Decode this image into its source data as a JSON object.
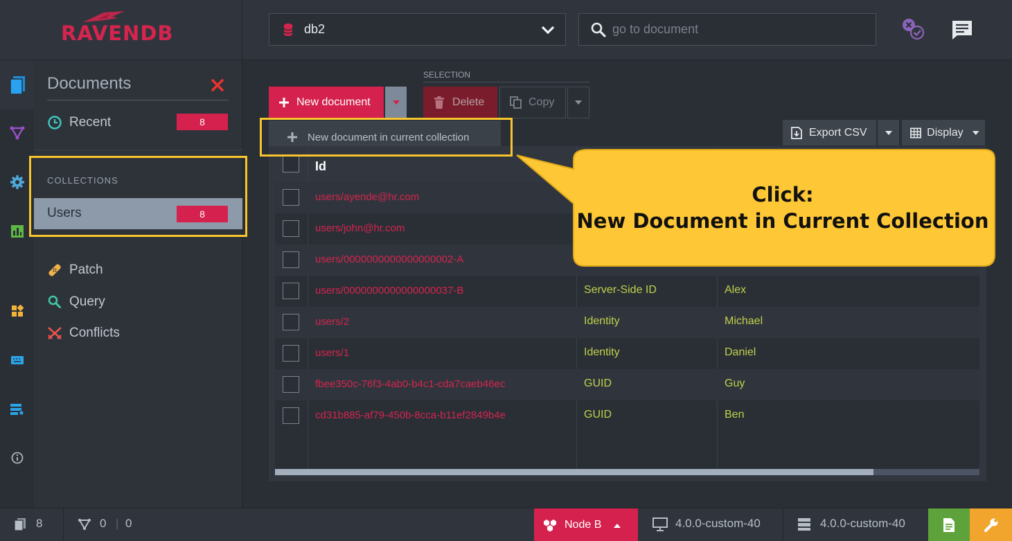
{
  "header": {
    "logo_text": "RAVENDB",
    "database": "db2",
    "search_placeholder": "go to document"
  },
  "menu": {
    "title": "Documents",
    "recent_label": "Recent",
    "recent_count": "8",
    "collections_heading": "COLLECTIONS",
    "collections": [
      {
        "label": "Users",
        "count": "8"
      }
    ],
    "items": [
      {
        "label": "Patch",
        "icon": "patch-icon"
      },
      {
        "label": "Query",
        "icon": "query-icon"
      },
      {
        "label": "Conflicts",
        "icon": "conflicts-icon"
      }
    ]
  },
  "toolbar": {
    "selection_label": "SELECTION",
    "new_document": "New document",
    "delete": "Delete",
    "copy": "Copy",
    "dropdown_item": "New document in current collection",
    "export_csv": "Export CSV",
    "display": "Display"
  },
  "grid": {
    "header_id": "Id",
    "rows": [
      {
        "id": "users/ayende@hr.com",
        "type": "",
        "name": ""
      },
      {
        "id": "users/john@hr.com",
        "type": "",
        "name": ""
      },
      {
        "id": "users/0000000000000000002-A",
        "type": "",
        "name": ""
      },
      {
        "id": "users/0000000000000000037-B",
        "type": "Server-Side ID",
        "name": "Alex"
      },
      {
        "id": "users/2",
        "type": "Identity",
        "name": "Michael"
      },
      {
        "id": "users/1",
        "type": "Identity",
        "name": "Daniel"
      },
      {
        "id": "fbee350c-76f3-4ab0-b4c1-cda7caeb46ec",
        "type": "GUID",
        "name": "Guy"
      },
      {
        "id": "cd31b885-af79-450b-8cca-b11ef2849b4e",
        "type": "GUID",
        "name": "Ben"
      }
    ],
    "scroll_position": 0.85
  },
  "callout": {
    "line1": "Click:",
    "line2": "New Document in Current Collection",
    "color": "#fdc735"
  },
  "footer": {
    "docs_count": "8",
    "indexes_count": "0",
    "indexes_errors": "0",
    "node": "Node B",
    "client_version": "4.0.0-custom-40",
    "server_version": "4.0.0-custom-40"
  },
  "colors": {
    "accent": "#d5214d",
    "highlight": "#f9c52c",
    "value_green": "#bfd14a"
  }
}
